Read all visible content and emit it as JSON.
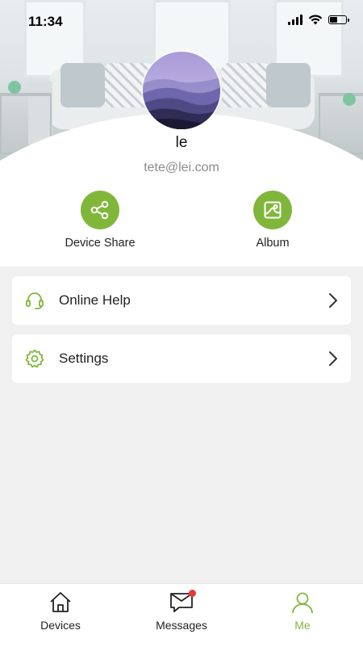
{
  "status_bar": {
    "time": "11:34",
    "battery_level": 0.45
  },
  "profile": {
    "name": "le",
    "email": "tete@lei.com"
  },
  "actions": [
    {
      "label": "Device Share",
      "icon": "share-icon"
    },
    {
      "label": "Album",
      "icon": "album-icon"
    }
  ],
  "menu": [
    {
      "label": "Online Help",
      "icon": "headset-icon"
    },
    {
      "label": "Settings",
      "icon": "gear-icon"
    }
  ],
  "tabs": [
    {
      "label": "Devices",
      "icon": "home-icon",
      "active": false
    },
    {
      "label": "Messages",
      "icon": "message-icon",
      "active": false,
      "has_badge": true
    },
    {
      "label": "Me",
      "icon": "user-icon",
      "active": true
    }
  ],
  "colors": {
    "accent": "#80b73b",
    "badge": "#e53935",
    "background": "#f0f0f0"
  }
}
